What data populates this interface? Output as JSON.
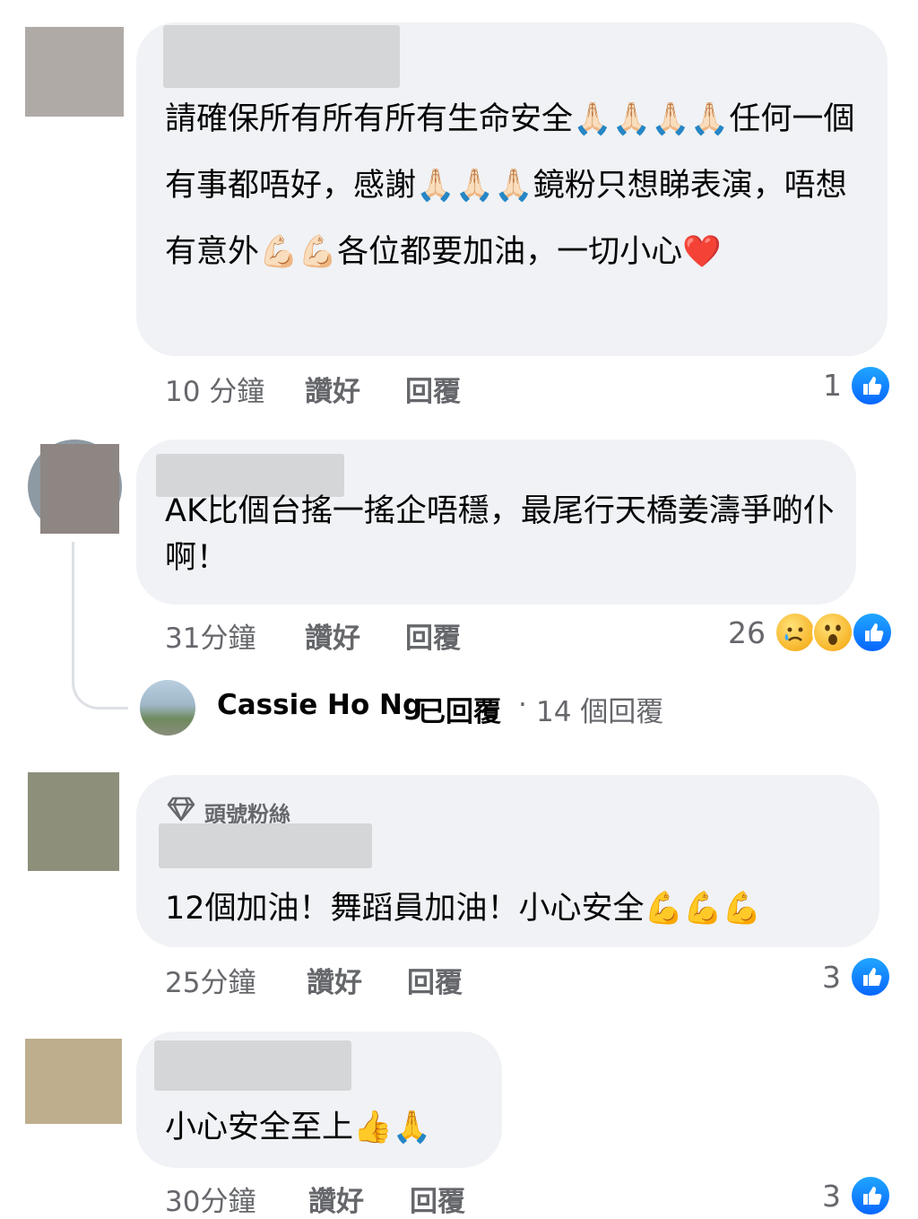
{
  "colors": {
    "bubble": "#f0f2f5",
    "meta_text": "#65676b",
    "like_blue": "#0866ff"
  },
  "comments": [
    {
      "text": "請確保所有所有所有生命安全🙏🏻🙏🏻🙏🏻🙏🏻任何一個有事都唔好，感謝🙏🏻🙏🏻🙏🏻鏡粉只想睇表演，唔想有意外💪🏻💪🏻各位都要加油，一切小心❤️",
      "time": "10 分鐘",
      "like_label": "讚好",
      "reply_label": "回覆",
      "reaction_count": "1"
    },
    {
      "text": "AK比個台搖一搖企唔穩，最尾行天橋姜濤爭啲仆啊！",
      "time": "31分鐘",
      "like_label": "讚好",
      "reply_label": "回覆",
      "reaction_count": "26",
      "replies_summary": {
        "replier_name": "Cassie Ho Ng",
        "replied_text": "已回覆",
        "separator": "·",
        "reply_count": "14 個回覆"
      }
    },
    {
      "badge": "頭號粉絲",
      "text": "12個加油！舞蹈員加油！小心安全💪💪💪",
      "time": "25分鐘",
      "like_label": "讚好",
      "reply_label": "回覆",
      "reaction_count": "3"
    },
    {
      "text": "小心安全至上👍🙏",
      "time": "30分鐘",
      "like_label": "讚好",
      "reply_label": "回覆",
      "reaction_count": "3"
    }
  ],
  "icons": {
    "like": "like-thumb-icon",
    "sad": "sad-cry-face-icon",
    "wow": "wow-face-icon",
    "diamond": "diamond-badge-icon"
  }
}
